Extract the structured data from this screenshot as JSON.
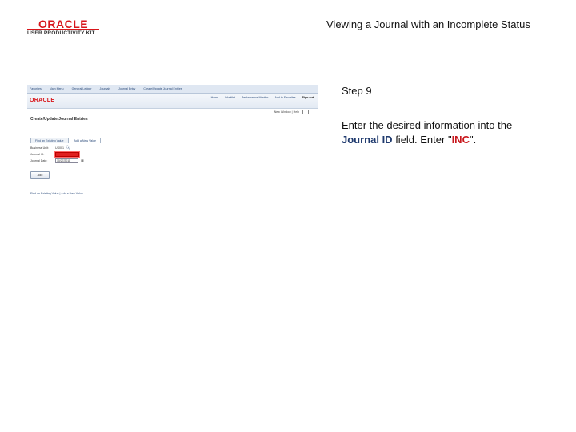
{
  "logo": {
    "brand": "ORACLE",
    "product": "USER PRODUCTIVITY KIT"
  },
  "slide_title": "Viewing a Journal with an Incomplete Status",
  "screenshot": {
    "top_nav": [
      "Favorites",
      "Main Menu",
      "General Ledger",
      "Journals",
      "Journal Entry",
      "Create/Update Journal Entries"
    ],
    "brand": "ORACLE",
    "header_links": [
      "Home",
      "Worklist",
      "Performance Monitor",
      "Add to Favorites",
      "Sign out"
    ],
    "worklist_label": "New Window | Help",
    "page_title": "Create/Update Journal Entries",
    "tabs": [
      "Find an Existing Value",
      "Add a New Value"
    ],
    "fields": {
      "business_unit_label": "Business Unit:",
      "business_unit_value": "US001",
      "journal_id_label": "Journal ID:",
      "journal_date_label": "Journal Date:",
      "journal_date_value": "10/27/2011"
    },
    "add_button": "Add",
    "footer_links": "Find an Existing Value | Add a New Value"
  },
  "step": "Step 9",
  "instruction": {
    "prefix": "Enter the desired information into the ",
    "field": "Journal ID",
    "middle": " field. Enter \"",
    "value": "INC",
    "suffix": "\"."
  }
}
